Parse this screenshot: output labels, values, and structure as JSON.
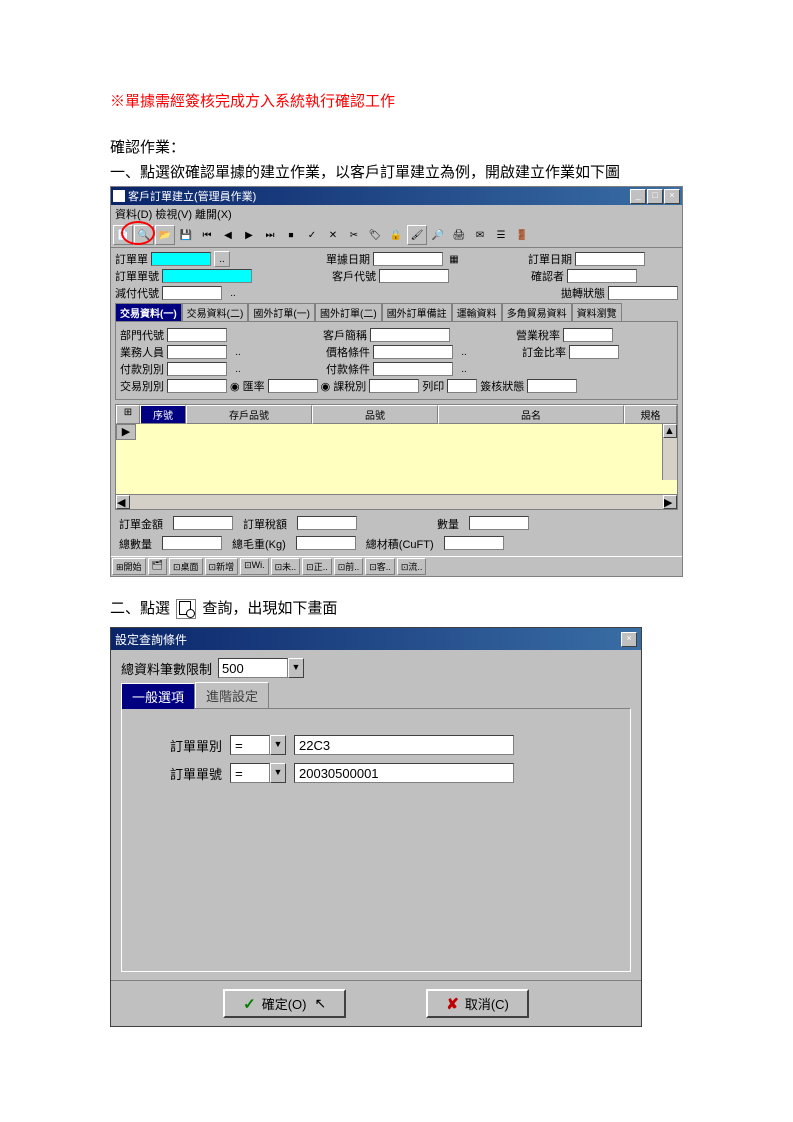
{
  "note": "※單據需經簽核完成方入系統執行確認工作",
  "heading": "確認作業：",
  "step1": "一、點選欲確認單據的建立作業，以客戶訂單建立為例，開啟建立作業如下圖",
  "step2_a": "二、點選",
  "step2_b": "查詢，出現如下畫面",
  "win1": {
    "title": "客戶訂單建立(管理員作業)",
    "menu": "資料(D) 檢視(V) 離開(X)",
    "labels": {
      "order_type": "訂單單",
      "order_no": "訂單單號",
      "dec_no": "減付代號",
      "doc_date": "單據日期",
      "cust_no": "客戶代號",
      "ord_date": "訂單日期",
      "confirmer": "確認者",
      "attach": "拋轉狀態"
    },
    "tabs": [
      "交易資料(一)",
      "交易資料(二)",
      "國外訂單(一)",
      "國外訂單(二)",
      "國外訂單備註",
      "運輸資料",
      "多角貿易資料",
      "資料瀏覽"
    ],
    "mid": {
      "dept": "部門代號",
      "agent": "業務人員",
      "pay_type": "付款別別",
      "trade": "交易別別",
      "cust2": "客戶簡稱",
      "price": "價格條件",
      "pay_cond": "付款條件",
      "rate": "匯率",
      "tax": "課稅別",
      "biz_tax": "營業稅率",
      "order_rate": "訂金比率",
      "print": "列印",
      "sign": "簽核狀態"
    },
    "grid_headers": [
      "序號",
      "存戶品號",
      "品號",
      "品名",
      "規格"
    ],
    "sum": {
      "amt": "訂單金額",
      "tax": "訂單稅額",
      "qty": "數量",
      "gw": "總毛重(Kg)",
      "cuft": "總材積(CuFT)"
    }
  },
  "dialog": {
    "title": "設定查詢條件",
    "limit_label": "總資料筆數限制",
    "limit_val": "500",
    "tabs": [
      "一般選項",
      "進階設定"
    ],
    "f1": {
      "label": "訂單單別",
      "op": "=",
      "val": "22C3"
    },
    "f2": {
      "label": "訂單單號",
      "op": "=",
      "val": "20030500001"
    },
    "ok": "確定(O)",
    "cancel": "取消(C)"
  }
}
